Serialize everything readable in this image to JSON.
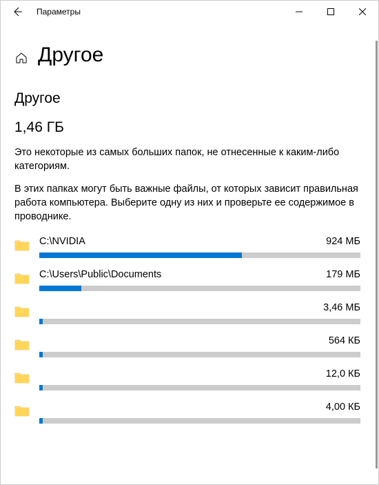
{
  "window": {
    "title": "Параметры"
  },
  "header": {
    "page_title": "Другое"
  },
  "section": {
    "heading": "Другое",
    "total": "1,46 ГБ",
    "desc1": "Это некоторые из самых больших папок, не отнесенные к каким-либо категориям.",
    "desc2": "В этих папках могут быть важные файлы, от которых зависит правильная работа компьютера. Выберите одну из них и проверьте ее содержимое в проводнике."
  },
  "folders": [
    {
      "path": "C:\\NVIDIA",
      "size": "924 МБ",
      "pct": 63
    },
    {
      "path": "C:\\Users\\Public\\Documents",
      "size": "179 МБ",
      "pct": 13
    },
    {
      "path": "",
      "size": "3,46 МБ",
      "pct": 1
    },
    {
      "path": "",
      "size": "564 КБ",
      "pct": 1
    },
    {
      "path": "",
      "size": "12,0 КБ",
      "pct": 1
    },
    {
      "path": "",
      "size": "4,00 КБ",
      "pct": 1
    }
  ]
}
